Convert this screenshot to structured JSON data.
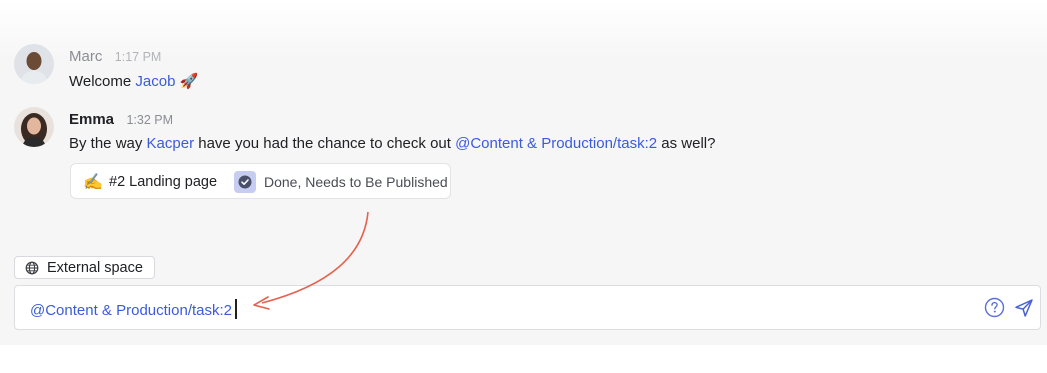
{
  "messages": [
    {
      "author": "Marc",
      "time": "1:17 PM",
      "text_prefix": "Welcome ",
      "mention": "Jacob",
      "emoji": "🚀"
    },
    {
      "author": "Emma",
      "time": "1:32 PM",
      "text_prefix": "By the way ",
      "mention1": "Kacper",
      "text_middle": " have you had the chance to check out ",
      "mention2": "@Content & Production/task:2",
      "text_suffix": " as well?"
    }
  ],
  "task_card": {
    "emoji": "✍️",
    "title": "#2 Landing page",
    "status": "Done, Needs to Be Published",
    "status_icon": "check-circle-icon"
  },
  "space_chip": {
    "icon": "globe-icon",
    "label": "External space"
  },
  "composer": {
    "value": "@Content & Production/task:2",
    "help_icon": "help-circle-icon",
    "send_icon": "send-icon"
  },
  "colors": {
    "mention": "#3b5bdb",
    "arrow": "#e5624e",
    "status_bg": "#c7cdf1"
  }
}
